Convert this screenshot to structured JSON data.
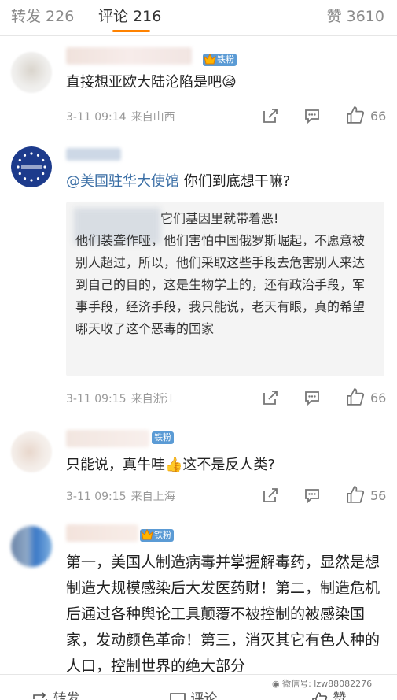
{
  "tabs": {
    "repost": "转发 226",
    "comment": "评论 216",
    "like": "赞 3610"
  },
  "comments": [
    {
      "badge": "铁粉",
      "text": "直接想亚欧大陆沦陷是吧😪",
      "time": "3-11 09:14",
      "source": "来自山西",
      "likes": "66"
    },
    {
      "mention": "@美国驻华大使馆",
      "text": " 你们到底想干嘛?",
      "quote_first": "它们基因里就带着恶!",
      "quote_rest": "他们装聋作哑，他们害怕中国俄罗斯崛起，不愿意被别人超过，所以，他们采取这些手段去危害别人来达到自己的目的，这是生物学上的，还有政治手段，军事手段，经济手段，我只能说，老天有眼，真的希望哪天收了这个恶毒的国家",
      "time": "3-11 09:15",
      "source": "来自浙江",
      "likes": "66"
    },
    {
      "badge": "铁粉",
      "text": "只能说，真牛哇👍这不是反人类?",
      "time": "3-11 09:15",
      "source": "来自上海",
      "likes": "56"
    },
    {
      "badge": "铁粉",
      "text": "第一，美国人制造病毒并掌握解毒药，显然是想制造大规模感染后大发医药财！第二，制造危机后通过各种舆论工具颠覆不被控制的被感染国家，发动颜色革命！第三，消灭其它有色人种的人口，控制世界的绝大部分"
    }
  ],
  "bottom_bar": {
    "repost": "转发",
    "comment": "评论",
    "like": "赞"
  },
  "watermark": "微信号: lzw88082276",
  "colors": {
    "accent": "#ff8200",
    "mention": "#3a6ea5",
    "badge": "#5b9bd5"
  }
}
